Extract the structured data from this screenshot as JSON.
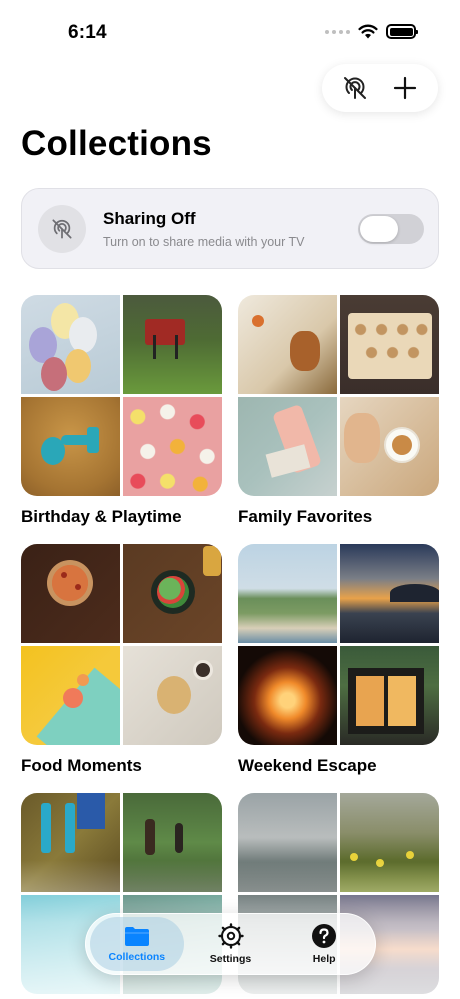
{
  "status_bar": {
    "time": "6:14"
  },
  "header": {
    "title": "Collections"
  },
  "toolbar": {
    "cast_icon": "cast-off-icon",
    "add_icon": "plus-icon"
  },
  "sharing": {
    "title": "Sharing Off",
    "subtitle": "Turn on to share media with your TV",
    "toggle_on": false
  },
  "collections": [
    {
      "name": "Birthday & Playtime"
    },
    {
      "name": "Family Favorites"
    },
    {
      "name": "Food Moments"
    },
    {
      "name": "Weekend Escape"
    },
    {
      "name": ""
    },
    {
      "name": ""
    }
  ],
  "tab_bar": {
    "tabs": [
      {
        "label": "Collections",
        "icon": "folder-icon",
        "active": true
      },
      {
        "label": "Settings",
        "icon": "gear-icon",
        "active": false
      },
      {
        "label": "Help",
        "icon": "help-icon",
        "active": false
      }
    ]
  },
  "colors": {
    "accent": "#0a84ff",
    "card_bg": "#f1f1f6",
    "toggle_off": "#d1d1d6"
  }
}
